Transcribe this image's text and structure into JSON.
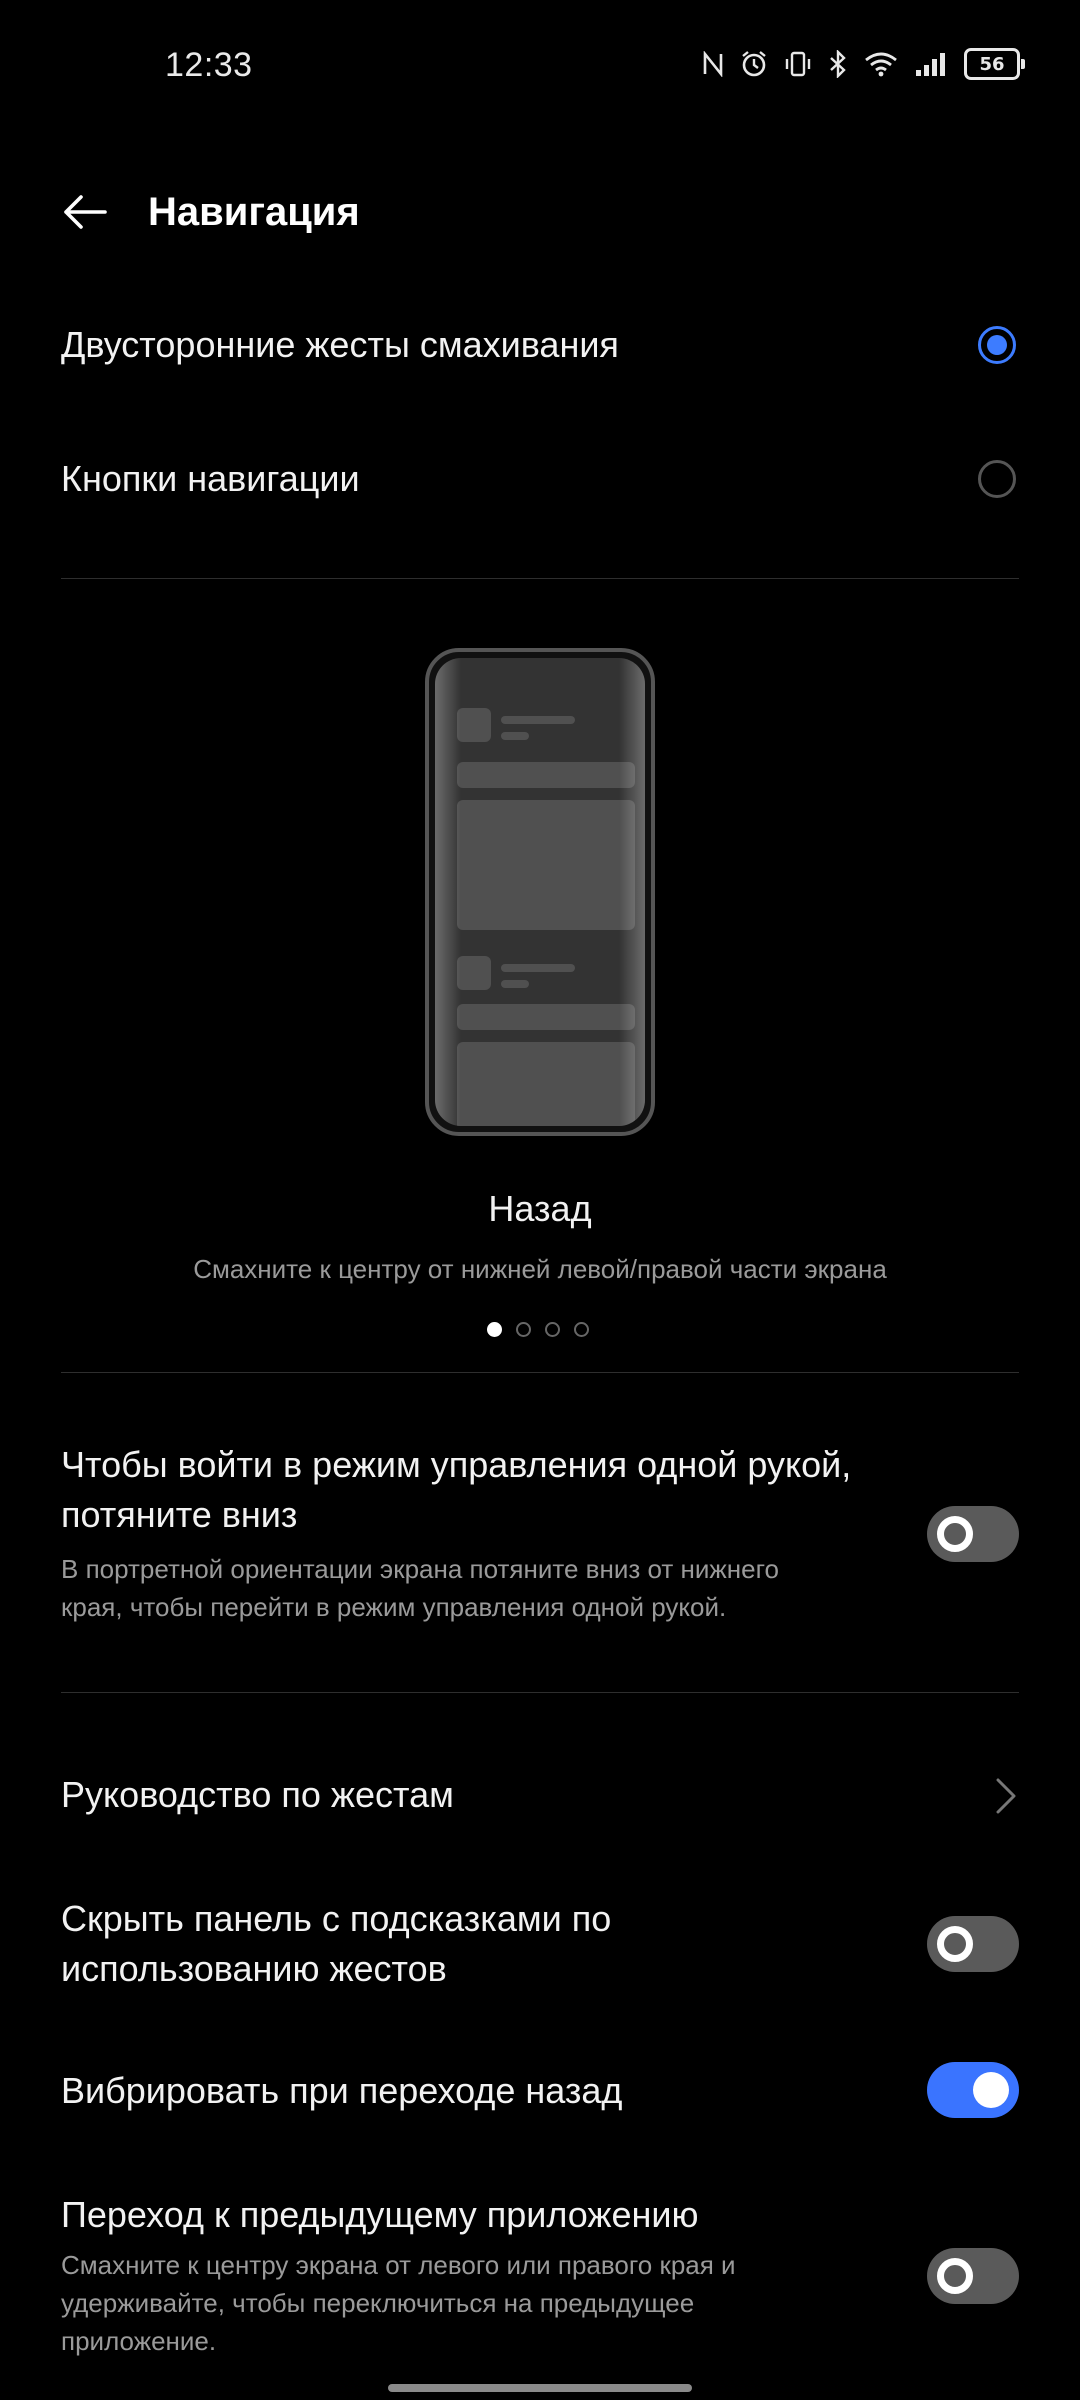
{
  "status_bar": {
    "time": "12:33",
    "icons": [
      "nfc-icon",
      "alarm-icon",
      "vibrate-icon",
      "bluetooth-icon",
      "wifi-icon",
      "signal-icon"
    ],
    "battery": "56"
  },
  "header": {
    "back_icon": "arrow-left-icon",
    "title": "Навигация"
  },
  "navigation_modes": [
    {
      "label": "Двусторонние жесты смахивания",
      "selected": true
    },
    {
      "label": "Кнопки навигации",
      "selected": false
    }
  ],
  "gesture_demo": {
    "title": "Назад",
    "description": "Смахните к центру от нижней левой/правой части экрана",
    "page_count": 4,
    "active_page": 1
  },
  "settings": {
    "one_hand": {
      "title": "Чтобы войти в режим управления одной рукой, потяните вниз",
      "description": "В портретной ориентации экрана потяните вниз от нижнего края, чтобы перейти в режим управления одной рукой.",
      "enabled": false
    },
    "gesture_guide": {
      "title": "Руководство по жестам",
      "icon": "chevron-right-icon"
    },
    "hide_hint_bar": {
      "title": "Скрыть панель с подсказками по использованию жестов",
      "enabled": false
    },
    "vibrate_back": {
      "title": "Вибрировать при переходе назад",
      "enabled": true
    },
    "previous_app": {
      "title": "Переход к предыдущему приложению",
      "description": "Смахните к центру экрана от левого или правого края и удерживайте, чтобы переключиться на предыдущее приложение.",
      "enabled": false
    }
  },
  "colors": {
    "background": "#000000",
    "accent": "#3D7CFF",
    "toggle_off": "#5A5A5A",
    "secondary_text": "#9A9A9A"
  }
}
